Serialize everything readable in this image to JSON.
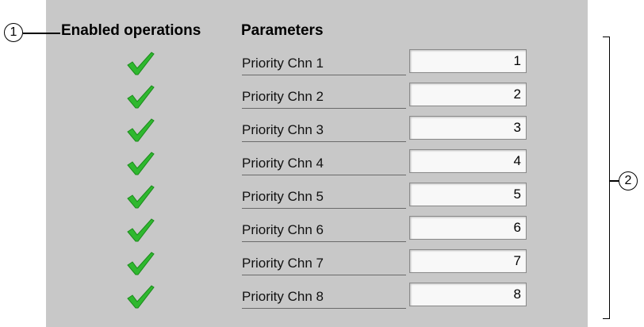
{
  "headers": {
    "enabled": "Enabled operations",
    "parameters": "Parameters"
  },
  "rows": [
    {
      "label": "Priority Chn 1",
      "value": "1"
    },
    {
      "label": "Priority Chn 2",
      "value": "2"
    },
    {
      "label": "Priority Chn 3",
      "value": "3"
    },
    {
      "label": "Priority Chn 4",
      "value": "4"
    },
    {
      "label": "Priority Chn 5",
      "value": "5"
    },
    {
      "label": "Priority Chn 6",
      "value": "6"
    },
    {
      "label": "Priority Chn 7",
      "value": "7"
    },
    {
      "label": "Priority Chn 8",
      "value": "8"
    }
  ],
  "callouts": {
    "one": "1",
    "two": "2"
  },
  "colors": {
    "panel": "#c8c8c8",
    "check": "#2fb82f"
  },
  "icons": {
    "enabled": "check-icon"
  }
}
